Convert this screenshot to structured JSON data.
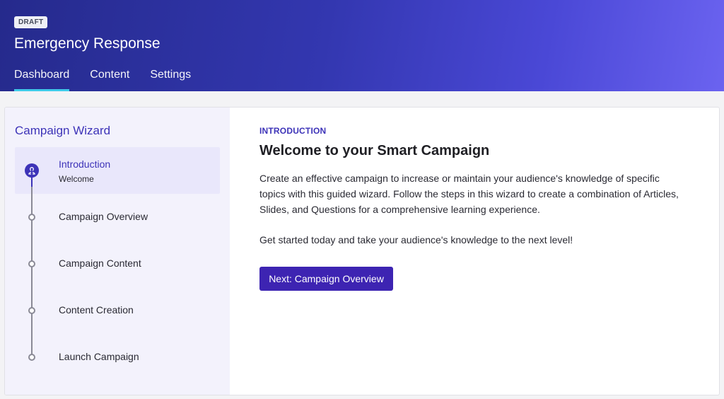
{
  "header": {
    "badge": "DRAFT",
    "title": "Emergency Response",
    "tabs": [
      {
        "label": "Dashboard",
        "active": true
      },
      {
        "label": "Content",
        "active": false
      },
      {
        "label": "Settings",
        "active": false
      }
    ]
  },
  "wizard": {
    "title": "Campaign Wizard",
    "steps": [
      {
        "label": "Introduction",
        "sublabel": "Welcome",
        "active": true,
        "icon": "user-icon"
      },
      {
        "label": "Campaign Overview",
        "active": false
      },
      {
        "label": "Campaign Content",
        "active": false
      },
      {
        "label": "Content Creation",
        "active": false
      },
      {
        "label": "Launch Campaign",
        "active": false
      }
    ]
  },
  "main": {
    "eyebrow": "INTRODUCTION",
    "headline": "Welcome to your Smart Campaign",
    "paragraph1": "Create an effective campaign to increase or maintain your audience's knowledge of specific topics with this guided wizard. Follow the steps in this wizard to create a combination of Articles, Slides, and Questions for a comprehensive learning experience.",
    "paragraph2": "Get started today and take your audience's knowledge to the next level!",
    "next_button": "Next: Campaign Overview"
  },
  "colors": {
    "accent": "#3d33b8",
    "tab_underline": "#3fd3ee",
    "button": "#3d24b2"
  }
}
